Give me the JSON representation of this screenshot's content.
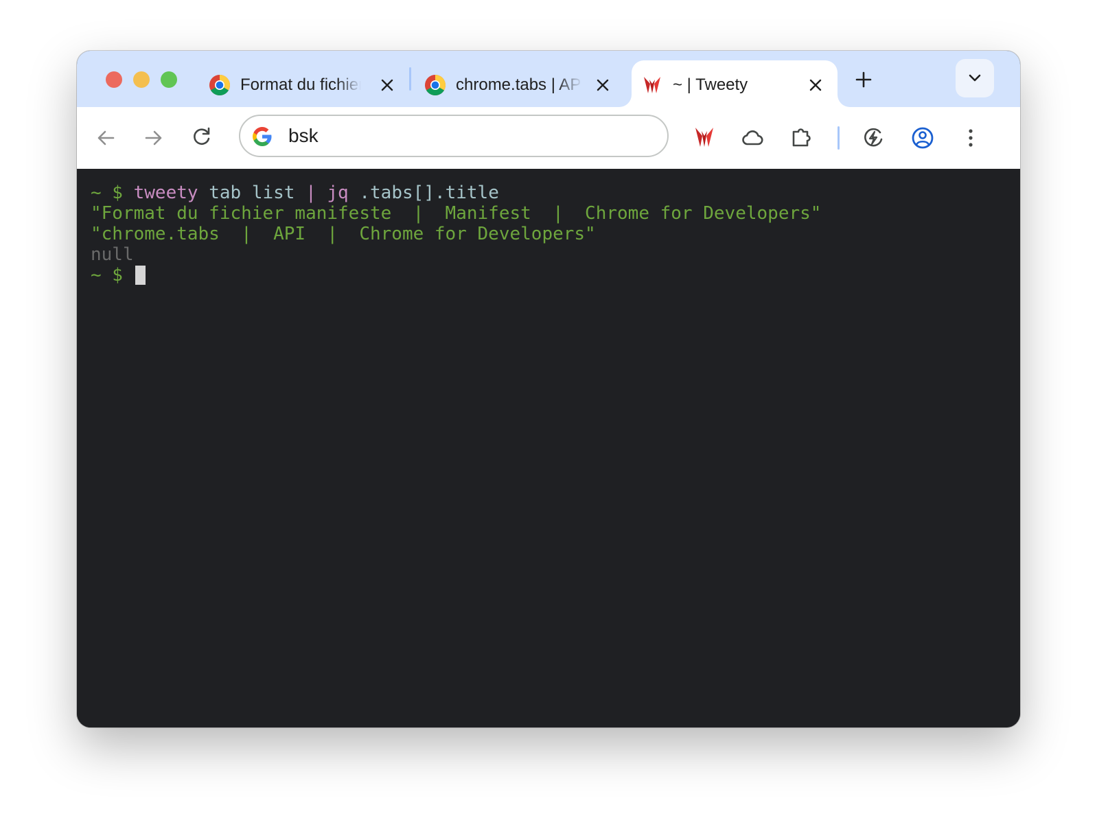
{
  "window": {
    "tabs": [
      {
        "title": "Format du fichier manifeste | Manifest | Chrome for Developers",
        "favicon": "chrome-icon",
        "active": false
      },
      {
        "title": "chrome.tabs | API | Chrome for Developers",
        "favicon": "chrome-icon",
        "active": false
      },
      {
        "title": "~ | Tweety",
        "favicon": "tweety-icon",
        "active": true
      }
    ]
  },
  "toolbar": {
    "omnibox_text": "bsk",
    "icons": [
      "back-icon",
      "forward-icon",
      "reload-icon",
      "google-icon",
      "tweety-extension-icon",
      "cloud-icon",
      "extensions-puzzle-icon",
      "performance-icon",
      "profile-icon",
      "more-menu-icon"
    ]
  },
  "terminal": {
    "prompt": "~ $",
    "command": {
      "program": "tweety",
      "args": "tab list",
      "pipe": "|",
      "filter_program": "jq",
      "filter_args": ".tabs[].title"
    },
    "output": [
      "\"Format du fichier manifeste  |  Manifest  |  Chrome for Developers\"",
      "\"chrome.tabs  |  API  |  Chrome for Developers\"",
      "null"
    ]
  },
  "colors": {
    "tabstrip": "#d3e3fd",
    "terminal_bg": "#1f2023",
    "prompt_green": "#6ea63d",
    "command_purple": "#c98dc2",
    "null_gray": "#6a6a6a"
  }
}
